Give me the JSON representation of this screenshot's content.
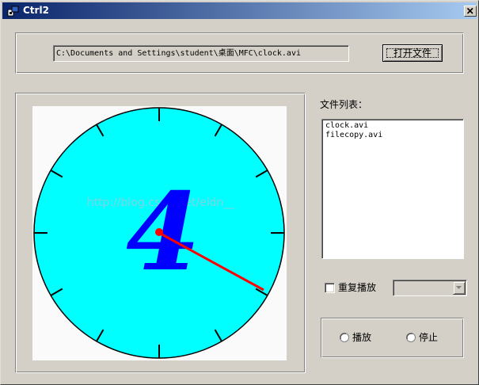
{
  "window": {
    "title": "Ctrl2"
  },
  "file_path": {
    "value": "C:\\Documents and Settings\\student\\桌面\\MFC\\clock.avi"
  },
  "open_button": {
    "label": "打开文件"
  },
  "file_list": {
    "label": "文件列表：",
    "items": [
      "clock.avi",
      "filecopy.avi"
    ]
  },
  "repeat": {
    "label": "重复播放",
    "checked": false
  },
  "combo": {
    "value": ""
  },
  "controls": {
    "play_label": "播放",
    "stop_label": "停止"
  },
  "clock": {
    "face_color": "#00ffff",
    "hand_color": "#ff0000",
    "numeral": "4",
    "numeral_color": "#0000ff",
    "watermark": "http://blog.csdn.net/eldn__"
  },
  "colors": {
    "window_bg": "#d4d0c8",
    "title_start": "#0a246a",
    "title_end": "#a6caf0"
  }
}
